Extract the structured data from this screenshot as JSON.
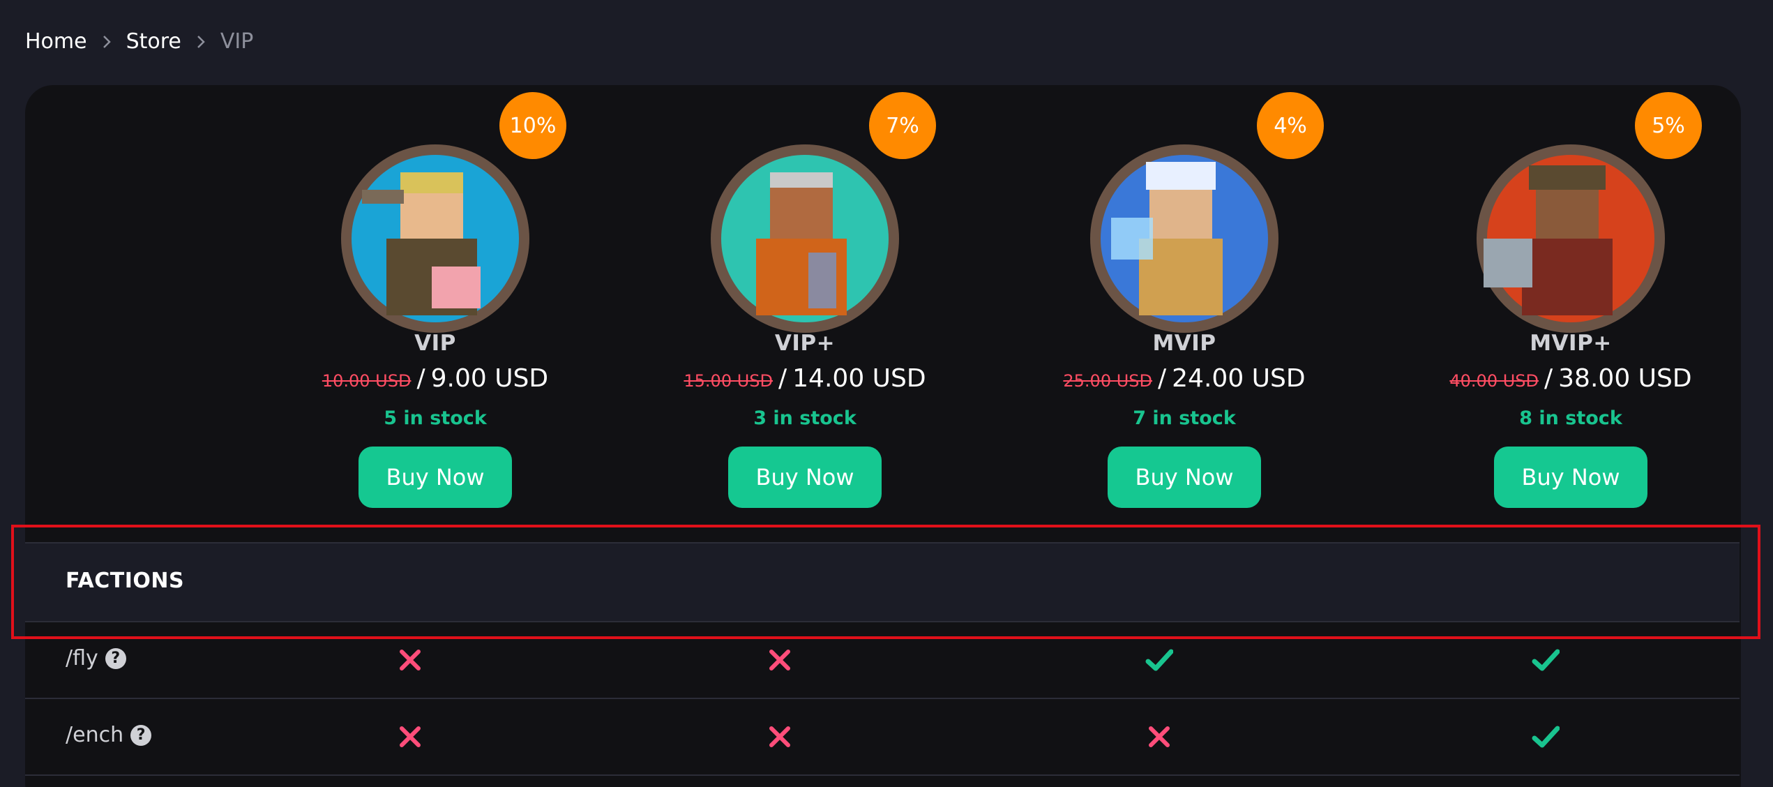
{
  "breadcrumb": {
    "items": [
      "Home",
      "Store",
      "VIP"
    ]
  },
  "products": [
    {
      "name": "VIP",
      "discount": "10%",
      "old_price": "10.00 USD",
      "price": "9.00 USD",
      "stock": "5 in stock",
      "buy_label": "Buy Now"
    },
    {
      "name": "VIP+",
      "discount": "7%",
      "old_price": "15.00 USD",
      "price": "14.00 USD",
      "stock": "3 in stock",
      "buy_label": "Buy Now"
    },
    {
      "name": "MVIP",
      "discount": "4%",
      "old_price": "25.00 USD",
      "price": "24.00 USD",
      "stock": "7 in stock",
      "buy_label": "Buy Now"
    },
    {
      "name": "MVIP+",
      "discount": "5%",
      "old_price": "40.00 USD",
      "price": "38.00 USD",
      "stock": "8 in stock",
      "buy_label": "Buy Now"
    }
  ],
  "section": {
    "title": "FACTIONS"
  },
  "features": [
    {
      "label": "/fly",
      "values": [
        false,
        false,
        true,
        true
      ]
    },
    {
      "label": "/ench",
      "values": [
        false,
        false,
        false,
        true
      ]
    }
  ],
  "icons": {
    "help": "question-circle-icon",
    "yes": "check-icon",
    "no": "cross-icon"
  },
  "colors": {
    "accent": "#15c891",
    "badge": "#ff8a00",
    "old_price": "#ff4d63",
    "cross": "#ff4d7a",
    "check": "#19c48f"
  }
}
